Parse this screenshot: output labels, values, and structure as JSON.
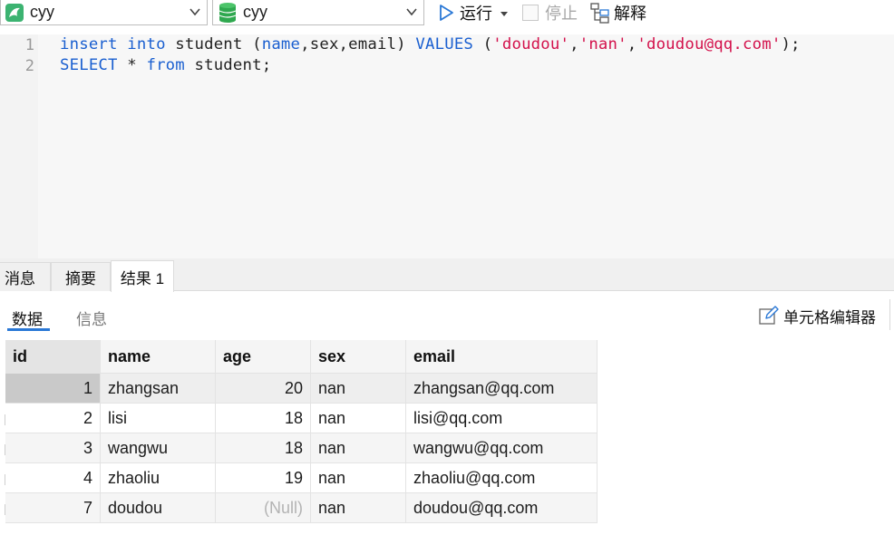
{
  "toolbar": {
    "connection": "cyy",
    "database": "cyy",
    "run_label": "运行",
    "stop_label": "停止",
    "explain_label": "解释"
  },
  "editor": {
    "line_numbers": [
      "1",
      "2"
    ],
    "lines": [
      [
        {
          "t": "insert",
          "c": "kw"
        },
        {
          "t": " ",
          "c": ""
        },
        {
          "t": "into",
          "c": "kw"
        },
        {
          "t": " student (",
          "c": ""
        },
        {
          "t": "name",
          "c": "kw"
        },
        {
          "t": ",sex,email) ",
          "c": ""
        },
        {
          "t": "VALUES",
          "c": "kw"
        },
        {
          "t": " (",
          "c": ""
        },
        {
          "t": "'doudou'",
          "c": "str"
        },
        {
          "t": ",",
          "c": ""
        },
        {
          "t": "'nan'",
          "c": "str"
        },
        {
          "t": ",",
          "c": ""
        },
        {
          "t": "'doudou@qq.com'",
          "c": "str"
        },
        {
          "t": ");",
          "c": ""
        }
      ],
      [
        {
          "t": "SELECT",
          "c": "kw"
        },
        {
          "t": " * ",
          "c": ""
        },
        {
          "t": "from",
          "c": "kw"
        },
        {
          "t": " student;",
          "c": ""
        }
      ]
    ]
  },
  "result_tabs": [
    "消息",
    "摘要",
    "结果 1"
  ],
  "sub_tabs": {
    "data": "数据",
    "info": "信息"
  },
  "cell_editor_label": "单元格编辑器",
  "table": {
    "columns": [
      "id",
      "name",
      "age",
      "sex",
      "email"
    ],
    "rows": [
      [
        "1",
        "zhangsan",
        "20",
        "nan",
        "zhangsan@qq.com"
      ],
      [
        "2",
        "lisi",
        "18",
        "nan",
        "lisi@qq.com"
      ],
      [
        "3",
        "wangwu",
        "18",
        "nan",
        "wangwu@qq.com"
      ],
      [
        "4",
        "zhaoliu",
        "19",
        "nan",
        "zhaoliu@qq.com"
      ],
      [
        "7",
        "doudou",
        "(Null)",
        "nan",
        "doudou@qq.com"
      ]
    ]
  },
  "colors": {
    "keyword": "#1a5fd0",
    "string": "#d3124c",
    "run_icon": "#2a78d6",
    "db_icon": "#2fa84f"
  },
  "icons": {
    "connection": "dolphin-connection-icon",
    "database": "database-icon",
    "run": "play-icon",
    "stop": "stop-checkbox-icon",
    "explain": "explain-icon",
    "cell_editor": "pencil-icon"
  }
}
